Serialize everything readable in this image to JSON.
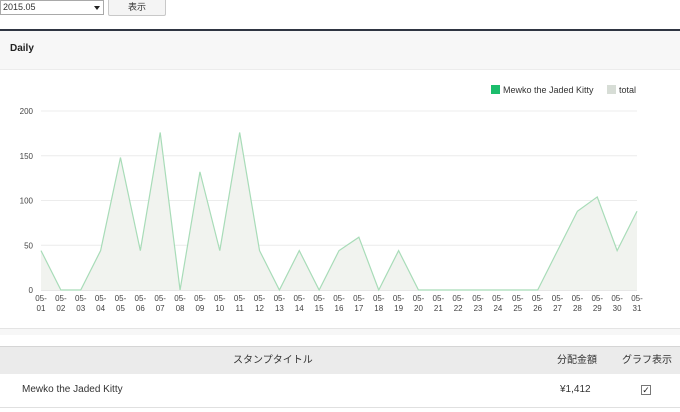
{
  "controls": {
    "month_value": "2015.05",
    "show_button_label": "表示"
  },
  "panel": {
    "title": "Daily"
  },
  "legend": [
    {
      "label": "Mewko the Jaded Kitty",
      "color": "#1bbd6c"
    },
    {
      "label": "total",
      "color": "#d7ddd6"
    }
  ],
  "chart_data": {
    "type": "area",
    "title": "",
    "xlabel": "",
    "ylabel": "",
    "ylim": [
      0,
      200
    ],
    "yticks": [
      0,
      50,
      100,
      150,
      200
    ],
    "grid": true,
    "legend_position": "top-right",
    "categories": [
      "05-01",
      "05-02",
      "05-03",
      "05-04",
      "05-05",
      "05-06",
      "05-07",
      "05-08",
      "05-09",
      "05-10",
      "05-11",
      "05-12",
      "05-13",
      "05-14",
      "05-15",
      "05-16",
      "05-17",
      "05-18",
      "05-19",
      "05-20",
      "05-21",
      "05-22",
      "05-23",
      "05-24",
      "05-25",
      "05-26",
      "05-27",
      "05-28",
      "05-29",
      "05-30",
      "05-31"
    ],
    "series": [
      {
        "name": "Mewko the Jaded Kitty",
        "color": "#1bbd6c",
        "values": [
          44,
          0,
          0,
          44,
          148,
          44,
          176,
          0,
          132,
          44,
          176,
          44,
          0,
          44,
          0,
          44,
          59,
          0,
          44,
          0,
          0,
          0,
          0,
          0,
          0,
          0,
          44,
          88,
          104,
          44,
          88
        ]
      },
      {
        "name": "total",
        "color": "#d7ddd6",
        "values": [
          44,
          0,
          0,
          44,
          148,
          44,
          176,
          0,
          132,
          44,
          176,
          44,
          0,
          44,
          0,
          44,
          59,
          0,
          44,
          0,
          0,
          0,
          0,
          0,
          0,
          0,
          44,
          88,
          104,
          44,
          88
        ]
      }
    ]
  },
  "table": {
    "headers": {
      "title": "スタンプタイトル",
      "amount": "分配金額",
      "graph": "グラフ表示"
    },
    "rows": [
      {
        "title": "Mewko the Jaded Kitty",
        "amount": "¥1,412",
        "checked": true
      }
    ]
  }
}
